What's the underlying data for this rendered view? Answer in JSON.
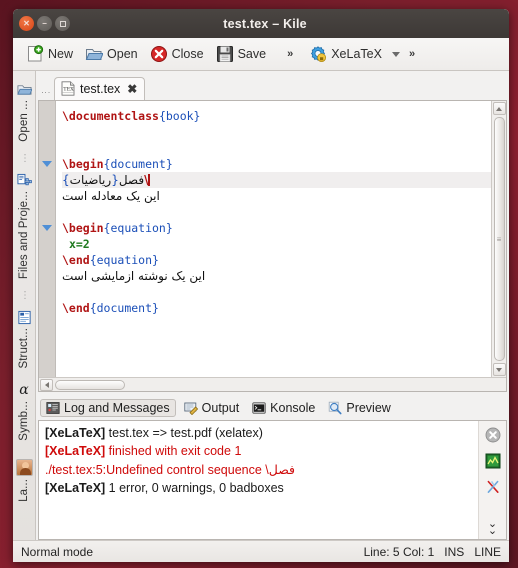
{
  "window": {
    "title": "test.tex – Kile",
    "buttons": {
      "close": "close-button",
      "minimize": "minimize-button",
      "maximize": "maximize-button"
    }
  },
  "toolbar": {
    "items": [
      {
        "label": "New",
        "icon": "new-document-icon"
      },
      {
        "label": "Open",
        "icon": "open-folder-icon"
      },
      {
        "label": "Close",
        "icon": "close-error-icon"
      },
      {
        "label": "Save",
        "icon": "floppy-save-icon"
      }
    ],
    "overflow_label": "»",
    "build": {
      "label": "XeLaTeX",
      "icon": "build-gear-icon"
    },
    "dropdown_icon": "chevron-down-icon",
    "extend_label": "»"
  },
  "sidebar": {
    "items": [
      {
        "label": "Open ...",
        "icon": "open-documents-icon"
      },
      {
        "label": "Files and Proje...",
        "icon": "files-projects-icon"
      },
      {
        "label": "Struct...",
        "icon": "structure-icon"
      },
      {
        "label": "Symb...",
        "icon": "symbols-alpha-icon"
      },
      {
        "label": "La...",
        "icon": "latex-avatar-icon"
      }
    ]
  },
  "editor": {
    "tab": {
      "label": "test.tex",
      "icon": "tex-file-icon",
      "close": "✖"
    },
    "lines": [
      {
        "type": "code",
        "tokens": [
          {
            "c": "kw",
            "t": "\\documentclass"
          },
          {
            "c": "br",
            "t": "{"
          },
          {
            "c": "br",
            "t": "book"
          },
          {
            "c": "br",
            "t": "}"
          }
        ]
      },
      {
        "type": "blank"
      },
      {
        "type": "blank"
      },
      {
        "type": "code",
        "fold": true,
        "tokens": [
          {
            "c": "kw",
            "t": "\\begin"
          },
          {
            "c": "br",
            "t": "{"
          },
          {
            "c": "br",
            "t": "document"
          },
          {
            "c": "br",
            "t": "}"
          }
        ]
      },
      {
        "type": "rtl-code",
        "highlight": true,
        "text": "\\فصل{ریاضیات}"
      },
      {
        "type": "rtl",
        "text": "این یک معادله است"
      },
      {
        "type": "blank"
      },
      {
        "type": "code",
        "fold": true,
        "tokens": [
          {
            "c": "kw",
            "t": "\\begin"
          },
          {
            "c": "br",
            "t": "{"
          },
          {
            "c": "br",
            "t": "equation"
          },
          {
            "c": "br",
            "t": "}"
          }
        ]
      },
      {
        "type": "code",
        "indent": true,
        "tokens": [
          {
            "c": "num",
            "t": "x=2"
          }
        ]
      },
      {
        "type": "code",
        "tokens": [
          {
            "c": "kw",
            "t": "\\end"
          },
          {
            "c": "br",
            "t": "{"
          },
          {
            "c": "br",
            "t": "equation"
          },
          {
            "c": "br",
            "t": "}"
          }
        ]
      },
      {
        "type": "rtl",
        "text": "این یک نوشته ازمایشی است"
      },
      {
        "type": "blank"
      },
      {
        "type": "code",
        "tokens": [
          {
            "c": "kw",
            "t": "\\end"
          },
          {
            "c": "br",
            "t": "{"
          },
          {
            "c": "br",
            "t": "document"
          },
          {
            "c": "br",
            "t": "}"
          }
        ]
      }
    ],
    "line1": "\\documentclass{book}",
    "line4": "\\begin{document}",
    "line5": "\\فصل{ریاضیات}",
    "line6": "این یک معادله است",
    "line8": "\\begin{equation}",
    "line9": "x=2",
    "line10": "\\end{equation}",
    "line11": "این یک نوشته ازمایشی است",
    "line13": "\\end{document}"
  },
  "bottom_panel": {
    "tabs": [
      {
        "label": "Log and Messages",
        "icon": "log-messages-icon",
        "active": true
      },
      {
        "label": "Output",
        "icon": "output-icon",
        "active": false
      },
      {
        "label": "Konsole",
        "icon": "konsole-terminal-icon",
        "active": false
      },
      {
        "label": "Preview",
        "icon": "preview-magnifier-icon",
        "active": false
      }
    ],
    "log": [
      {
        "tag": "[XeLaTeX]",
        "rest": " test.tex => test.pdf (xelatex)",
        "error": false
      },
      {
        "tag": "[XeLaTeX]",
        "rest": " finished with exit code 1",
        "error": true
      },
      {
        "tag": "",
        "rest": "./test.tex:5:Undefined control sequence \\فصل",
        "error": true
      },
      {
        "tag": "[XeLaTeX]",
        "rest": " 1 error, 0 warnings, 0 badboxes",
        "error": false
      }
    ],
    "side_icons": [
      {
        "icon": "close-panel-icon"
      },
      {
        "icon": "green-chart-icon"
      },
      {
        "icon": "kile-pen-icon"
      },
      {
        "icon": "chevron-double-down-icon"
      }
    ]
  },
  "statusbar": {
    "mode": "Normal mode",
    "line": "Line: 5 Col: 1",
    "insert": "INS",
    "selection": "LINE"
  },
  "colors": {
    "desktop": "#7a1f2c",
    "titlebar": "#3d3936",
    "keyword_red": "#b01414",
    "brace_blue": "#1b4fb8",
    "number_green": "#1f7a1f",
    "error_red": "#cf0a0a",
    "fold_blue": "#4f8fd6"
  }
}
